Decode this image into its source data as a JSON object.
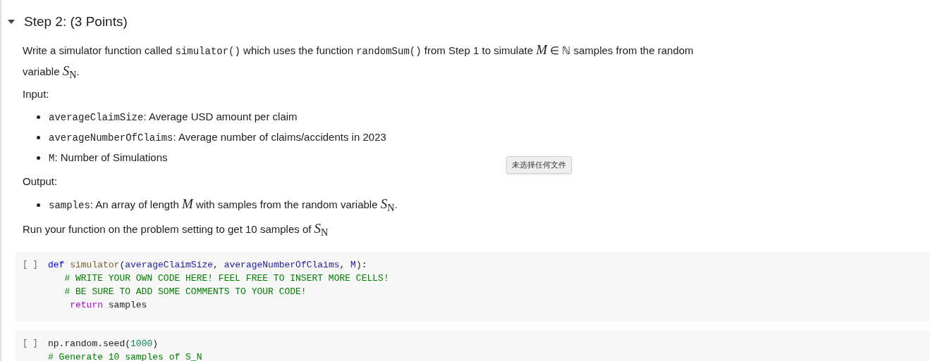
{
  "section": {
    "title": "Step 2: (3 Points)",
    "expanded": true
  },
  "paragraphs": [
    {
      "kind": "para",
      "segments": [
        {
          "kind": "text",
          "text": "Write a simulator function called "
        },
        {
          "kind": "code",
          "text": "simulator()"
        },
        {
          "kind": "text",
          "text": " which uses the function "
        },
        {
          "kind": "code",
          "text": "randomSum()"
        },
        {
          "kind": "text",
          "text": " from Step 1 to simulate "
        },
        {
          "kind": "math",
          "text": "*M*"
        },
        {
          "kind": "text",
          "text": " ∈ ℕ samples from the random variable "
        },
        {
          "kind": "math",
          "text": "*S*$_{N}$"
        },
        {
          "kind": "text",
          "text": "."
        }
      ]
    },
    {
      "kind": "para",
      "segments": [
        {
          "kind": "text",
          "text": "Input:"
        }
      ]
    },
    {
      "kind": "list",
      "items": [
        {
          "segments": [
            {
              "kind": "code",
              "text": "averageClaimSize"
            },
            {
              "kind": "text",
              "text": ": Average USD amount per claim"
            }
          ]
        },
        {
          "segments": [
            {
              "kind": "code",
              "text": "averageNumberOfClaims"
            },
            {
              "kind": "text",
              "text": ": Average number of claims/accidents in 2023"
            }
          ]
        },
        {
          "segments": [
            {
              "kind": "code",
              "text": "M"
            },
            {
              "kind": "text",
              "text": ": Number of Simulations"
            }
          ]
        }
      ]
    },
    {
      "kind": "para",
      "segments": [
        {
          "kind": "text",
          "text": "Output:"
        }
      ]
    },
    {
      "kind": "list",
      "items": [
        {
          "segments": [
            {
              "kind": "code",
              "text": "samples"
            },
            {
              "kind": "text",
              "text": ": An array of length "
            },
            {
              "kind": "math",
              "text": "*M*"
            },
            {
              "kind": "text",
              "text": " with samples from the random variable "
            },
            {
              "kind": "math",
              "text": "*S*$_{N}$"
            },
            {
              "kind": "text",
              "text": "."
            }
          ]
        }
      ]
    },
    {
      "kind": "para",
      "segments": [
        {
          "kind": "text",
          "text": "Run your function on the problem setting to get 10 samples of "
        },
        {
          "kind": "math",
          "text": "*S*$_{N}$"
        }
      ]
    }
  ],
  "file_button": "未选择任何文件",
  "code_cells": [
    {
      "run_label": "[ ]",
      "lines": [
        [
          {
            "kind": "keyword",
            "text": "def"
          },
          {
            "kind": "function",
            "text": " simulator"
          },
          {
            "kind": "punct",
            "text": "("
          },
          {
            "kind": "param",
            "text": "averageClaimSize"
          },
          {
            "kind": "plain",
            "text": ", "
          },
          {
            "kind": "param",
            "text": "averageNumberOfClaims"
          },
          {
            "kind": "plain",
            "text": ", "
          },
          {
            "kind": "param",
            "text": "M"
          },
          {
            "kind": "punct",
            "text": "):"
          }
        ],
        [
          {
            "kind": "comment",
            "text": "   # WRITE YOUR OWN CODE HERE! FEEL FREE TO INSERT MORE CELLS!"
          }
        ],
        [
          {
            "kind": "comment",
            "text": "   # BE SURE TO ADD SOME COMMENTS TO YOUR CODE!"
          }
        ],
        [
          {
            "kind": "return",
            "text": "    return"
          },
          {
            "kind": "plain",
            "text": " samples"
          }
        ]
      ]
    },
    {
      "run_label": "[ ]",
      "lines": [
        [
          {
            "kind": "plain",
            "text": "np.random.seed"
          },
          {
            "kind": "punct",
            "text": "("
          },
          {
            "kind": "number",
            "text": "1000"
          },
          {
            "kind": "punct",
            "text": ")"
          }
        ],
        [
          {
            "kind": "comment",
            "text": "# Generate 10 samples of S_N"
          }
        ]
      ]
    }
  ]
}
